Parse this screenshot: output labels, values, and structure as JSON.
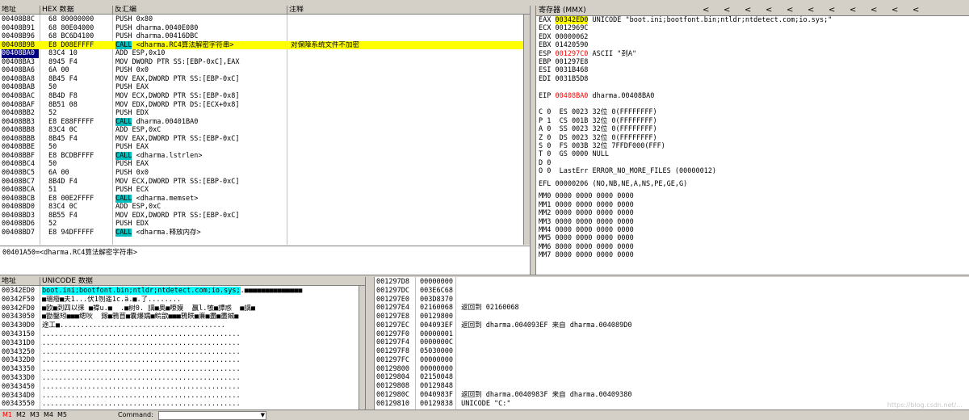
{
  "disasm": {
    "headers": [
      "地址",
      "HEX 数据",
      "反汇编",
      "注释"
    ],
    "rows": [
      {
        "addr": "00408B8C",
        "hex": "68 80000000",
        "pre": "",
        "kw": "PUSH",
        "post": " 0x80",
        "comment": ""
      },
      {
        "addr": "00408B91",
        "hex": "68 80E04000",
        "pre": "",
        "kw": "PUSH",
        "post": " dharma.0040E080",
        "comment": ""
      },
      {
        "addr": "00408B96",
        "hex": "68 BC6D4100",
        "pre": "",
        "kw": "PUSH",
        "post": " dharma.00416DBC",
        "comment": ""
      },
      {
        "addr": "00408B9B",
        "hex": "E8 D08EFFFF",
        "pre": "",
        "kw": "CALL",
        "post": " <dharma.RC4算法解密字符串>",
        "comment": "对保障系统文件不加密"
      },
      {
        "addr": "00408BA0",
        "hex": "83C4 10",
        "pre": "",
        "kw": "ADD",
        "post": " ESP,0x10",
        "comment": ""
      },
      {
        "addr": "00408BA3",
        "hex": "8945 F4",
        "pre": "",
        "kw": "MOV",
        "post": " DWORD PTR SS:[EBP-0xC],EAX",
        "comment": ""
      },
      {
        "addr": "00408BA6",
        "hex": "6A 00",
        "pre": "",
        "kw": "PUSH",
        "post": " 0x0",
        "comment": ""
      },
      {
        "addr": "00408BA8",
        "hex": "8B45 F4",
        "pre": "",
        "kw": "MOV",
        "post": " EAX,DWORD PTR SS:[EBP-0xC]",
        "comment": ""
      },
      {
        "addr": "00408BAB",
        "hex": "50",
        "pre": "",
        "kw": "PUSH",
        "post": " EAX",
        "comment": ""
      },
      {
        "addr": "00408BAC",
        "hex": "8B4D F8",
        "pre": "",
        "kw": "MOV",
        "post": " ECX,DWORD PTR SS:[EBP-0x8]",
        "comment": ""
      },
      {
        "addr": "00408BAF",
        "hex": "8B51 08",
        "pre": "",
        "kw": "MOV",
        "post": " EDX,DWORD PTR DS:[ECX+0x8]",
        "comment": ""
      },
      {
        "addr": "00408BB2",
        "hex": "52",
        "pre": "",
        "kw": "PUSH",
        "post": " EDX",
        "comment": ""
      },
      {
        "addr": "00408BB3",
        "hex": "E8 E88FFFFF",
        "pre": "",
        "kw": "CALL",
        "post": " dharma.00401BA0",
        "comment": ""
      },
      {
        "addr": "00408BB8",
        "hex": "83C4 0C",
        "pre": "",
        "kw": "ADD",
        "post": " ESP,0xC",
        "comment": ""
      },
      {
        "addr": "00408BBB",
        "hex": "8B45 F4",
        "pre": "",
        "kw": "MOV",
        "post": " EAX,DWORD PTR SS:[EBP-0xC]",
        "comment": ""
      },
      {
        "addr": "00408BBE",
        "hex": "50",
        "pre": "",
        "kw": "PUSH",
        "post": " EAX",
        "comment": ""
      },
      {
        "addr": "00408BBF",
        "hex": "E8 BCDBFFFF",
        "pre": "",
        "kw": "CALL",
        "post": " <dharma.lstrlen>",
        "comment": ""
      },
      {
        "addr": "00408BC4",
        "hex": "50",
        "pre": "",
        "kw": "PUSH",
        "post": " EAX",
        "comment": ""
      },
      {
        "addr": "00408BC5",
        "hex": "6A 00",
        "pre": "",
        "kw": "PUSH",
        "post": " 0x0",
        "comment": ""
      },
      {
        "addr": "00408BC7",
        "hex": "8B4D F4",
        "pre": "",
        "kw": "MOV",
        "post": " ECX,DWORD PTR SS:[EBP-0xC]",
        "comment": ""
      },
      {
        "addr": "00408BCA",
        "hex": "51",
        "pre": "",
        "kw": "PUSH",
        "post": " ECX",
        "comment": ""
      },
      {
        "addr": "00408BCB",
        "hex": "E8 00E2FFFF",
        "pre": "",
        "kw": "CALL",
        "post": " <dharma.memset>",
        "comment": ""
      },
      {
        "addr": "00408BD0",
        "hex": "83C4 0C",
        "pre": "",
        "kw": "ADD",
        "post": " ESP,0xC",
        "comment": ""
      },
      {
        "addr": "00408BD3",
        "hex": "8B55 F4",
        "pre": "",
        "kw": "MOV",
        "post": " EDX,DWORD PTR SS:[EBP-0xC]",
        "comment": ""
      },
      {
        "addr": "00408BD6",
        "hex": "52",
        "pre": "",
        "kw": "PUSH",
        "post": " EDX",
        "comment": ""
      },
      {
        "addr": "00408BD7",
        "hex": "E8 94DFFFFF",
        "pre": "",
        "kw": "CALL",
        "post": " <dharma.释放内存>",
        "comment": ""
      }
    ],
    "info_line": "00401A50=<dharma.RC4算法解密字符串>"
  },
  "registers": {
    "title": "寄存器 (MMX)",
    "nav_arrows": [
      "<",
      "<",
      "<",
      "<",
      "<",
      "<",
      "<",
      "<",
      "<",
      "<",
      "<"
    ],
    "gp": [
      {
        "name": "EAX",
        "val": "00342ED0",
        "note": " UNICODE \"boot.ini;bootfont.bin;ntldr;ntdetect.com;io.sys;\"",
        "valstyle": "hi"
      },
      {
        "name": "ECX",
        "val": "0012969C",
        "note": "",
        "valstyle": ""
      },
      {
        "name": "EDX",
        "val": "00000062",
        "note": "",
        "valstyle": ""
      },
      {
        "name": "EBX",
        "val": "01420590",
        "note": "",
        "valstyle": ""
      },
      {
        "name": "ESP",
        "val": "001297C0",
        "note": " ASCII \"刭A\"",
        "valstyle": "red"
      },
      {
        "name": "EBP",
        "val": "001297E8",
        "note": "",
        "valstyle": ""
      },
      {
        "name": "ESI",
        "val": "0031B468",
        "note": "",
        "valstyle": ""
      },
      {
        "name": "EDI",
        "val": "0031B5D8",
        "note": "",
        "valstyle": ""
      }
    ],
    "eip": {
      "name": "EIP",
      "val": "00408BA0",
      "note": " dharma.00408BA0"
    },
    "flags": [
      "C 0  ES 0023 32位 0(FFFFFFFF)",
      "P 1  CS 001B 32位 0(FFFFFFFF)",
      "A 0  SS 0023 32位 0(FFFFFFFF)",
      "Z 0  DS 0023 32位 0(FFFFFFFF)",
      "S 0  FS 003B 32位 7FFDF000(FFF)",
      "T 0  GS 0000 NULL",
      "D 0",
      "O 0  LastErr ERROR_NO_MORE_FILES (00000012)"
    ],
    "efl": "EFL 00000206 (NO,NB,NE,A,NS,PE,GE,G)",
    "mmx": [
      "MM0 0000 0000 0000 0000",
      "MM1 0000 0000 0000 0000",
      "MM2 0000 0000 0000 0000",
      "MM3 0000 0000 0000 0000",
      "MM4 0000 0000 0000 0000",
      "MM5 0000 0000 0000 0000",
      "MM6 8000 0000 0000 0000",
      "MM7 8000 0000 0000 0000"
    ]
  },
  "dump": {
    "headers": [
      "地址",
      "UNICODE 数据"
    ],
    "rows": [
      {
        "addr": "00342ED0",
        "data": "boot.ini;bootfont.bin;ntldr;ntdetect.com;io.sys;",
        "tail": ".■■■■■■■■■■■■■■"
      },
      {
        "addr": "00342F50",
        "data": "",
        "tail": "■瑂癈■夫1...伏1刎遥1c.ä.■.了........"
      },
      {
        "addr": "00342FD0",
        "data": "",
        "tail": "■欧■刭四以徕 ■禕u.■  .■树0. 謧■奥■嘹嫫  贏ĺ.敂■譚惑  ■謧■"
      },
      {
        "addr": "00343050",
        "data": "",
        "tail": "■勖鑿矧■■■缌吙  鎵■鴉苜■囊爆嬬■鲩歆■■■鴉眹■亷■盡■盡絾■"
      },
      {
        "addr": "003430D0",
        "data": "",
        "tail": "途工■........................................"
      },
      {
        "addr": "00343150",
        "data": "",
        "tail": "................................................"
      },
      {
        "addr": "003431D0",
        "data": "",
        "tail": "................................................"
      },
      {
        "addr": "00343250",
        "data": "",
        "tail": "................................................"
      },
      {
        "addr": "003432D0",
        "data": "",
        "tail": "................................................"
      },
      {
        "addr": "00343350",
        "data": "",
        "tail": "................................................"
      },
      {
        "addr": "003433D0",
        "data": "",
        "tail": "................................................"
      },
      {
        "addr": "00343450",
        "data": "",
        "tail": "................................................"
      },
      {
        "addr": "003434D0",
        "data": "",
        "tail": "................................................"
      },
      {
        "addr": "00343550",
        "data": "",
        "tail": "................................................"
      }
    ]
  },
  "stack": {
    "rows": [
      {
        "addr": "001297D8",
        "val": "00000000",
        "note": ""
      },
      {
        "addr": "001297DC",
        "val": "003E6C68",
        "note": ""
      },
      {
        "addr": "001297E0",
        "val": "003D8370",
        "note": ""
      },
      {
        "addr": "001297E4",
        "val": "02160068",
        "note": " 返回到 02160068"
      },
      {
        "addr": "001297E8",
        "val": "00129800",
        "note": ""
      },
      {
        "addr": "001297EC",
        "val": "004093EF",
        "note": " 返回到 dharma.004093EF 来自 dharma.004089D0"
      },
      {
        "addr": "001297F0",
        "val": "00000001",
        "note": ""
      },
      {
        "addr": "001297F4",
        "val": "0000000C",
        "note": ""
      },
      {
        "addr": "001297F8",
        "val": "05030000",
        "note": ""
      },
      {
        "addr": "001297FC",
        "val": "00000000",
        "note": ""
      },
      {
        "addr": "00129800",
        "val": "00000000",
        "note": ""
      },
      {
        "addr": "00129804",
        "val": "02150048",
        "note": ""
      },
      {
        "addr": "00129808",
        "val": "00129848",
        "note": ""
      },
      {
        "addr": "0012980C",
        "val": "0040983F",
        "note": " 返回到 dharma.0040983F 来自 dharma.00409380"
      },
      {
        "addr": "00129810",
        "val": "00129838",
        "note": " UNICODE \"C:\""
      }
    ],
    "watermark": "https://blog.csdn.net/..."
  },
  "statusbar": {
    "tabs": [
      "M1",
      "M2",
      "M3",
      "M4",
      "M5"
    ],
    "command_label": "Command:"
  }
}
